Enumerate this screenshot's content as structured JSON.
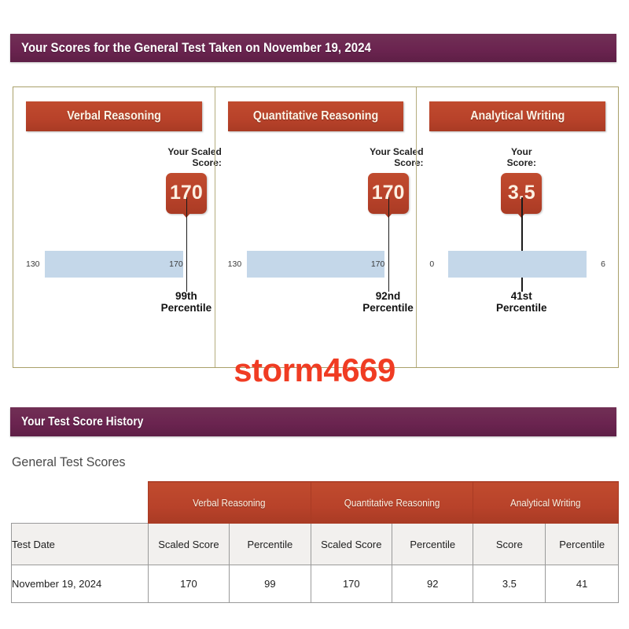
{
  "scores_section": {
    "banner_title": "Your Scores for the General Test Taken on November 19, 2024",
    "panels": [
      {
        "title": "Verbal Reasoning",
        "score_label": "Your Scaled\nScore:",
        "score_label_line1": "Your Scaled",
        "score_label_line2": "Score:",
        "score": "170",
        "scale_min_label": "130",
        "scale_max_label": "170",
        "scale_inner_label": "170",
        "marker_percent": 100,
        "percentile_line1": "99th",
        "percentile_line2": "Percentile",
        "label_align": "right"
      },
      {
        "title": "Quantitative Reasoning",
        "score_label_line1": "Your Scaled",
        "score_label_line2": "Score:",
        "score": "170",
        "scale_min_label": "130",
        "scale_max_label": "170",
        "scale_inner_label": "170",
        "marker_percent": 100,
        "percentile_line1": "92nd",
        "percentile_line2": "Percentile",
        "label_align": "right"
      },
      {
        "title": "Analytical Writing",
        "score_label_line1": "Your",
        "score_label_line2": "Score:",
        "score": "3.5",
        "scale_min_label": "0",
        "scale_max_label": "6",
        "scale_inner_label": "",
        "marker_percent": 58,
        "percentile_line1": "41st",
        "percentile_line2": "Percentile",
        "label_align": "center"
      }
    ]
  },
  "watermark": {
    "text": "storm4669"
  },
  "history_section": {
    "banner_title": "Your Test Score History",
    "subtitle": "General Test Scores",
    "table": {
      "group_headers": [
        "",
        "Verbal Reasoning",
        "Quantitative Reasoning",
        "Analytical Writing"
      ],
      "sub_headers": [
        "Test Date",
        "Scaled Score",
        "Percentile",
        "Scaled Score",
        "Percentile",
        "Score",
        "Percentile"
      ],
      "rows": [
        [
          "November 19, 2024",
          "170",
          "99",
          "170",
          "92",
          "3.5",
          "41"
        ]
      ]
    }
  },
  "colors": {
    "banner_purple": "#6b2450",
    "header_red": "#b8422a",
    "scale_blue": "#c4d7e9",
    "card_border": "#a9a06a",
    "watermark_red": "#f03c23"
  },
  "chart_data": {
    "type": "bar",
    "title": "Your Scores for the General Test Taken on November 19, 2024",
    "categories": [
      "Verbal Reasoning",
      "Quantitative Reasoning",
      "Analytical Writing"
    ],
    "series": [
      {
        "name": "Scaled Score",
        "values": [
          170,
          170,
          3.5
        ]
      },
      {
        "name": "Percentile",
        "values": [
          99,
          92,
          41
        ]
      }
    ],
    "axis_ranges": [
      [
        130,
        170
      ],
      [
        130,
        170
      ],
      [
        0,
        6
      ]
    ],
    "grid": false,
    "legend": "none"
  }
}
